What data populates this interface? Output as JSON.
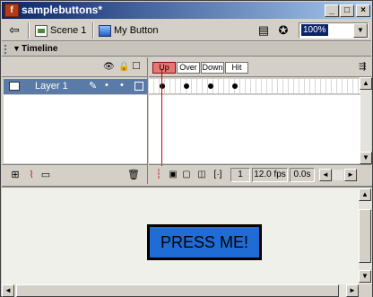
{
  "window": {
    "title": "samplebuttons*",
    "minimize_glyph": "_",
    "maximize_glyph": "□",
    "close_glyph": "×"
  },
  "scene_bar": {
    "back_glyph": "⇦",
    "scene_label": "Scene 1",
    "symbol_label": "My Button",
    "edit_scene_glyph": "▤",
    "edit_symbol_glyph": "✪",
    "zoom_value": "100%"
  },
  "timeline": {
    "title": "Timeline",
    "toggle_glyph": "▼",
    "eye_glyph": "👁",
    "lock_glyph": "🔒",
    "outline_glyph": "□",
    "frame_labels": [
      "Up",
      "Over",
      "Down",
      "Hit"
    ],
    "layer": {
      "name": "Layer 1",
      "pencil_glyph": "✎",
      "dot_glyph": "•"
    },
    "layer_tools": {
      "add_layer_glyph": "⊞",
      "motion_guide_glyph": "⌇",
      "folder_glyph": "▭",
      "trash_glyph": "🗑"
    },
    "frame_tools": {
      "center_glyph": "┆",
      "onion_glyph": "▣",
      "onion_outline_glyph": "▢",
      "multi_edit_glyph": "◫",
      "markers_glyph": "[·]"
    },
    "current_frame": "1",
    "frame_rate": "12.0 fps",
    "elapsed": "0.0s",
    "scroll_left_glyph": "◄",
    "scroll_right_glyph": "►",
    "scroll_up_glyph": "▲",
    "scroll_down_glyph": "▼"
  },
  "stage": {
    "button_label": "PRESS ME!"
  },
  "colors": {
    "titlebar_start": "#0a246a",
    "titlebar_end": "#a6caf0",
    "button_fill": "#1f6cd6",
    "active_frame_label": "#e87474",
    "playhead": "#cc0000",
    "layer_selected": "#5a7aa8"
  }
}
